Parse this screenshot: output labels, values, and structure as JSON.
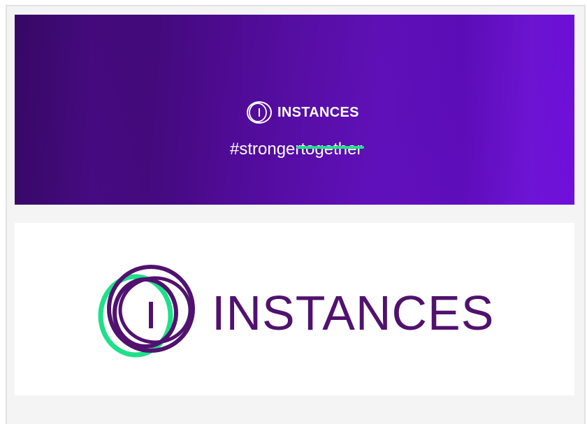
{
  "banner": {
    "brand": "INSTANCES",
    "hashtag": "#strongertogether"
  },
  "logo_card": {
    "brand": "INSTANCES"
  },
  "colors": {
    "purple_dark": "#3e0a72",
    "purple_bright": "#6f10dc",
    "brand_purple": "#50126e",
    "accent_green": "#1fe08a"
  },
  "icons": {
    "banner_logo": "instances-rings-icon",
    "main_logo": "instances-rings-icon"
  }
}
